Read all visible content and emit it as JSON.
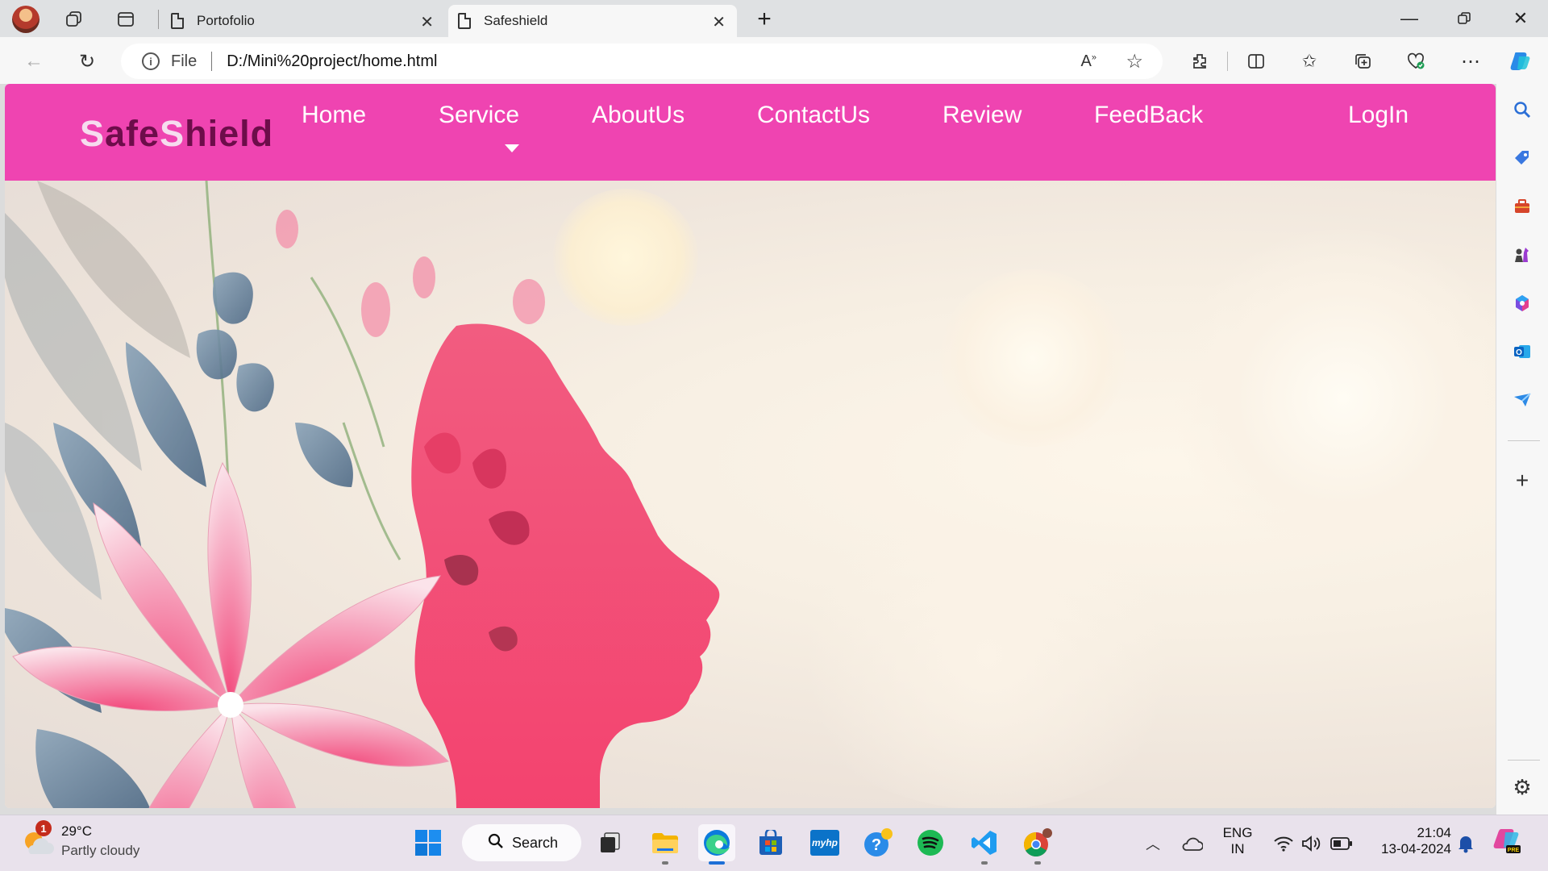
{
  "browser": {
    "tabs": [
      {
        "title": "Portofolio",
        "active": false
      },
      {
        "title": "Safeshield",
        "active": true
      }
    ],
    "address": {
      "scheme_label": "File",
      "url": "D:/Mini%20project/home.html"
    }
  },
  "site": {
    "logo": {
      "part1": "S",
      "part2": "afe",
      "part3": "S",
      "part4": "hield"
    },
    "nav": [
      "Home",
      "Service",
      "AboutUs",
      "ContactUs",
      "Review",
      "FeedBack"
    ],
    "login": "LogIn",
    "accent_color": "#ef44b1"
  },
  "taskbar": {
    "weather": {
      "temp": "29°C",
      "condition": "Partly cloudy",
      "badge": "1"
    },
    "search_label": "Search",
    "language": {
      "line1": "ENG",
      "line2": "IN"
    },
    "clock": {
      "time": "21:04",
      "date": "13-04-2024"
    }
  }
}
